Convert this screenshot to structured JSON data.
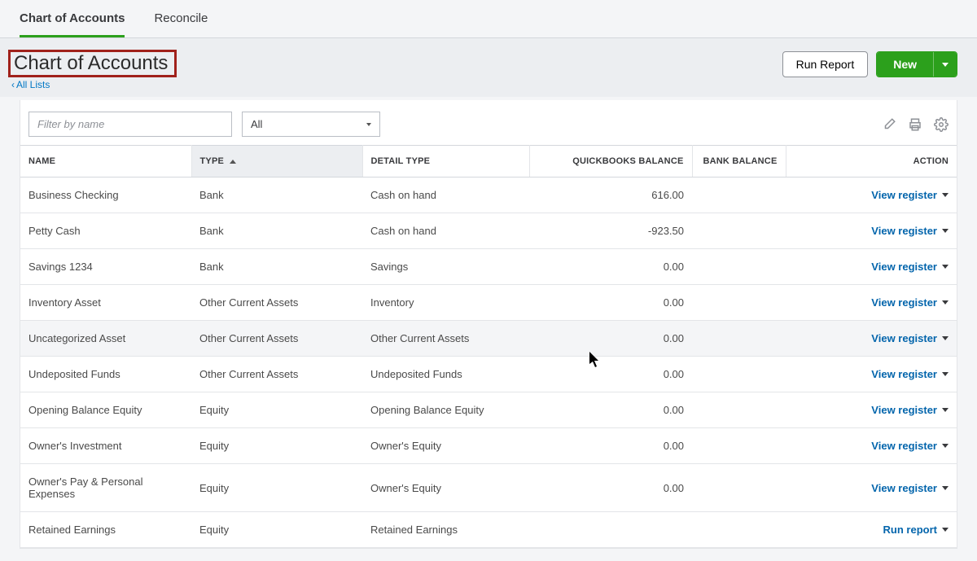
{
  "tabs": {
    "chart": "Chart of Accounts",
    "reconcile": "Reconcile"
  },
  "page_title": "Chart of Accounts",
  "back_link": "All Lists",
  "buttons": {
    "run_report": "Run Report",
    "new": "New"
  },
  "filter": {
    "placeholder": "Filter by name",
    "dropdown": "All"
  },
  "columns": {
    "name": "NAME",
    "type": "TYPE",
    "detail_type": "DETAIL TYPE",
    "qb_balance": "QUICKBOOKS BALANCE",
    "bank_balance": "BANK BALANCE",
    "action": "ACTION"
  },
  "action_labels": {
    "view_register": "View register",
    "run_report": "Run report"
  },
  "rows": [
    {
      "name": "Business Checking",
      "type": "Bank",
      "detail": "Cash on hand",
      "qb": "616.00",
      "bank": "",
      "action": "view_register"
    },
    {
      "name": "Petty Cash",
      "type": "Bank",
      "detail": "Cash on hand",
      "qb": "-923.50",
      "bank": "",
      "action": "view_register"
    },
    {
      "name": "Savings 1234",
      "type": "Bank",
      "detail": "Savings",
      "qb": "0.00",
      "bank": "",
      "action": "view_register"
    },
    {
      "name": "Inventory Asset",
      "type": "Other Current Assets",
      "detail": "Inventory",
      "qb": "0.00",
      "bank": "",
      "action": "view_register"
    },
    {
      "name": "Uncategorized Asset",
      "type": "Other Current Assets",
      "detail": "Other Current Assets",
      "qb": "0.00",
      "bank": "",
      "action": "view_register",
      "hover": true
    },
    {
      "name": "Undeposited Funds",
      "type": "Other Current Assets",
      "detail": "Undeposited Funds",
      "qb": "0.00",
      "bank": "",
      "action": "view_register"
    },
    {
      "name": "Opening Balance Equity",
      "type": "Equity",
      "detail": "Opening Balance Equity",
      "qb": "0.00",
      "bank": "",
      "action": "view_register"
    },
    {
      "name": "Owner's Investment",
      "type": "Equity",
      "detail": "Owner's Equity",
      "qb": "0.00",
      "bank": "",
      "action": "view_register"
    },
    {
      "name": "Owner's Pay & Personal Expenses",
      "type": "Equity",
      "detail": "Owner's Equity",
      "qb": "0.00",
      "bank": "",
      "action": "view_register"
    },
    {
      "name": "Retained Earnings",
      "type": "Equity",
      "detail": "Retained Earnings",
      "qb": "",
      "bank": "",
      "action": "run_report"
    }
  ]
}
